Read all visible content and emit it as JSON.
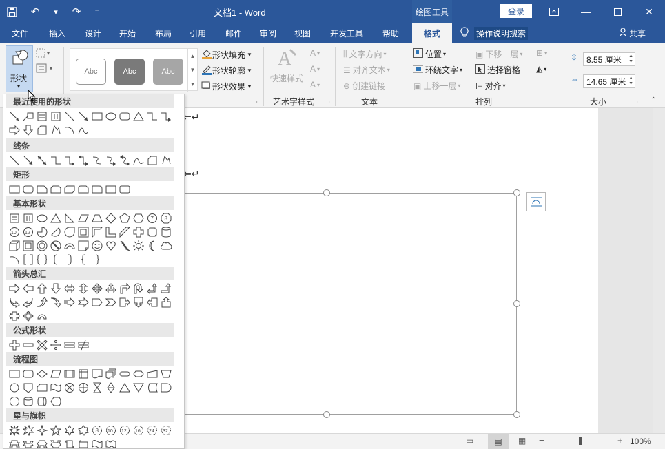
{
  "titlebar": {
    "title": "文档1  -  Word",
    "context_tab": "绘图工具",
    "login": "登录",
    "qat_more": "="
  },
  "tabs": [
    "文件",
    "插入",
    "设计",
    "开始",
    "布局",
    "引用",
    "邮件",
    "审阅",
    "视图",
    "开发工具",
    "帮助",
    "格式"
  ],
  "tellme": "操作说明搜索",
  "share": "共享",
  "ribbon": {
    "shapes_label": "形状",
    "style_sample": "Abc",
    "shape_fill": "形状填充",
    "shape_outline": "形状轮廓",
    "shape_effects": "形状效果",
    "quick_styles": "快速样式",
    "wordart_group": "艺术字样式",
    "text_direction": "文字方向",
    "align_text": "对齐文本",
    "create_link": "创建链接",
    "text_group": "文本",
    "position": "位置",
    "wrap_text": "环绕文字",
    "bring_forward": "上移一层",
    "send_backward": "下移一层",
    "selection_pane": "选择窗格",
    "align": "对齐",
    "arrange_group": "排列",
    "height": "8.55 厘米",
    "width": "14.65 厘米",
    "size_group": "大小"
  },
  "shapes_panel": {
    "categories": [
      "最近使用的形状",
      "线条",
      "矩形",
      "基本形状",
      "箭头总汇",
      "公式形状",
      "流程图",
      "星与旗帜"
    ]
  },
  "statusbar": {
    "zoom": "100%"
  },
  "colors": {
    "title_bar": "#2b579a",
    "ribbon": "#f3f3f3",
    "shape_style_1": "#ffffff",
    "shape_style_2": "#7a7a7a",
    "shape_style_3": "#a6a6a6"
  }
}
